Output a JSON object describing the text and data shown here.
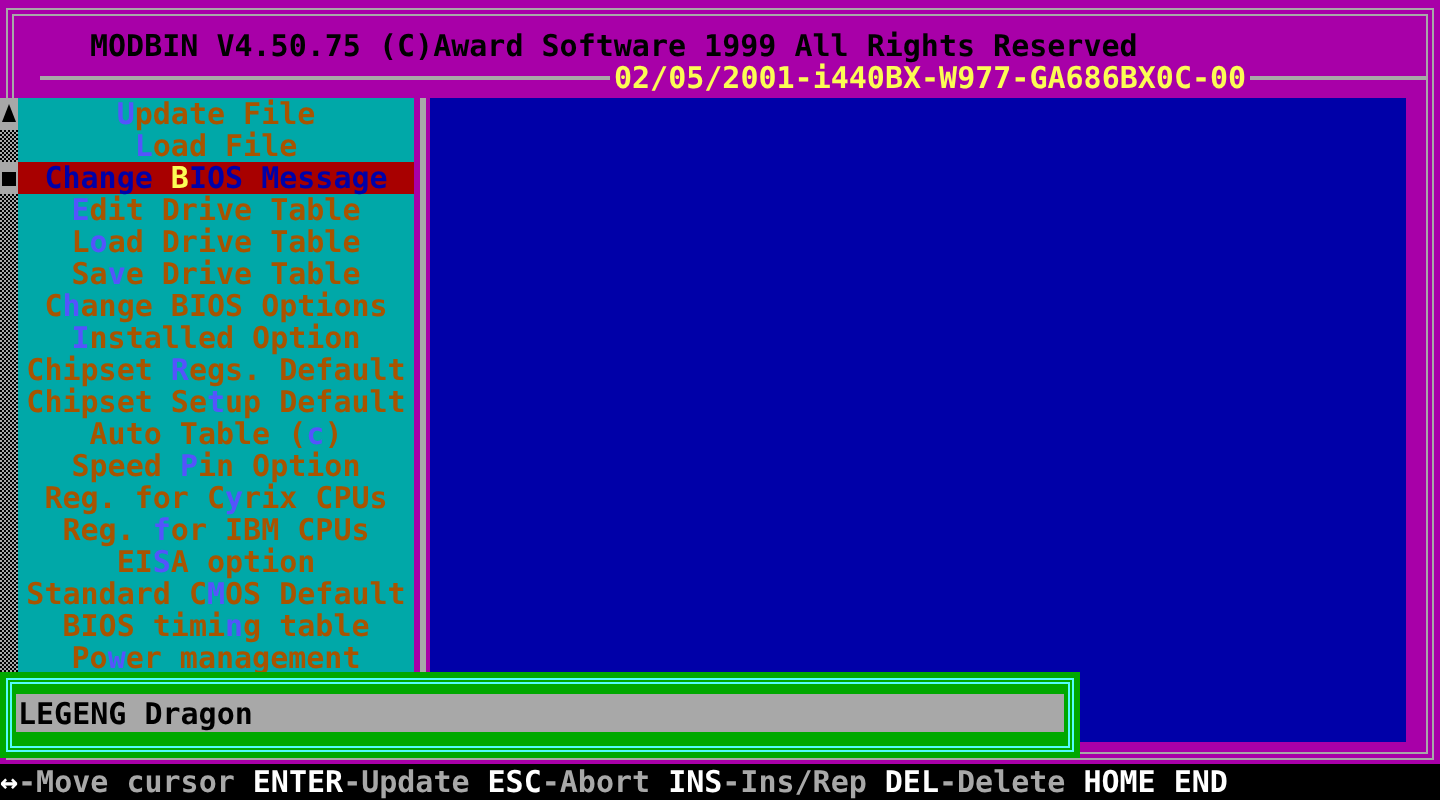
{
  "header": {
    "title": "MODBIN V4.50.75 (C)Award Software 1999 All Rights Reserved",
    "bios_id": "02/05/2001-i440BX-W977-GA686BX0C-00"
  },
  "menu": [
    {
      "hotkey": "U",
      "rest": "pdate File",
      "selected": false
    },
    {
      "hotkey": "L",
      "rest": "oad File",
      "selected": false
    },
    {
      "prefix": "Change ",
      "hotkey": "B",
      "rest": "IOS Message",
      "selected": true
    },
    {
      "hotkey": "E",
      "rest": "dit Drive Table",
      "selected": false
    },
    {
      "prefix": "L",
      "hotkey": "o",
      "rest": "ad Drive Table",
      "selected": false
    },
    {
      "prefix": "Sa",
      "hotkey": "v",
      "rest": "e Drive Table",
      "selected": false
    },
    {
      "prefix": "C",
      "hotkey": "h",
      "rest": "ange BIOS Options",
      "selected": false
    },
    {
      "hotkey": "I",
      "rest": "nstalled Option",
      "selected": false
    },
    {
      "prefix": "Chipset ",
      "hotkey": "R",
      "rest": "egs. Default",
      "selected": false
    },
    {
      "prefix": "Chipset Se",
      "hotkey": "t",
      "rest": "up Default",
      "selected": false
    },
    {
      "prefix": "Auto Table (",
      "hotkey": "c",
      "rest": ")",
      "selected": false
    },
    {
      "prefix": "Speed ",
      "hotkey": "P",
      "rest": "in Option",
      "selected": false
    },
    {
      "prefix": "Reg. for C",
      "hotkey": "y",
      "rest": "rix CPUs",
      "selected": false
    },
    {
      "prefix": "Reg. ",
      "hotkey": "f",
      "rest": "or IBM CPUs",
      "selected": false
    },
    {
      "prefix": "EI",
      "hotkey": "S",
      "rest": "A option",
      "selected": false
    },
    {
      "prefix": "Standard C",
      "hotkey": "M",
      "rest": "OS Default",
      "selected": false
    },
    {
      "prefix": "BIOS timi",
      "hotkey": "n",
      "rest": "g table",
      "selected": false
    },
    {
      "prefix": "Po",
      "hotkey": "w",
      "rest": "er management",
      "selected": false
    }
  ],
  "dialog": {
    "value": "LEGENG Dragon"
  },
  "status_bar": [
    {
      "key": "↔",
      "desc": "-Move cursor"
    },
    {
      "key": "ENTER",
      "desc": "-Update"
    },
    {
      "key": "ESC",
      "desc": "-Abort"
    },
    {
      "key": "INS",
      "desc": "-Ins/Rep"
    },
    {
      "key": "DEL",
      "desc": "-Delete"
    },
    {
      "key": "HOME"
    },
    {
      "key": "END"
    }
  ]
}
